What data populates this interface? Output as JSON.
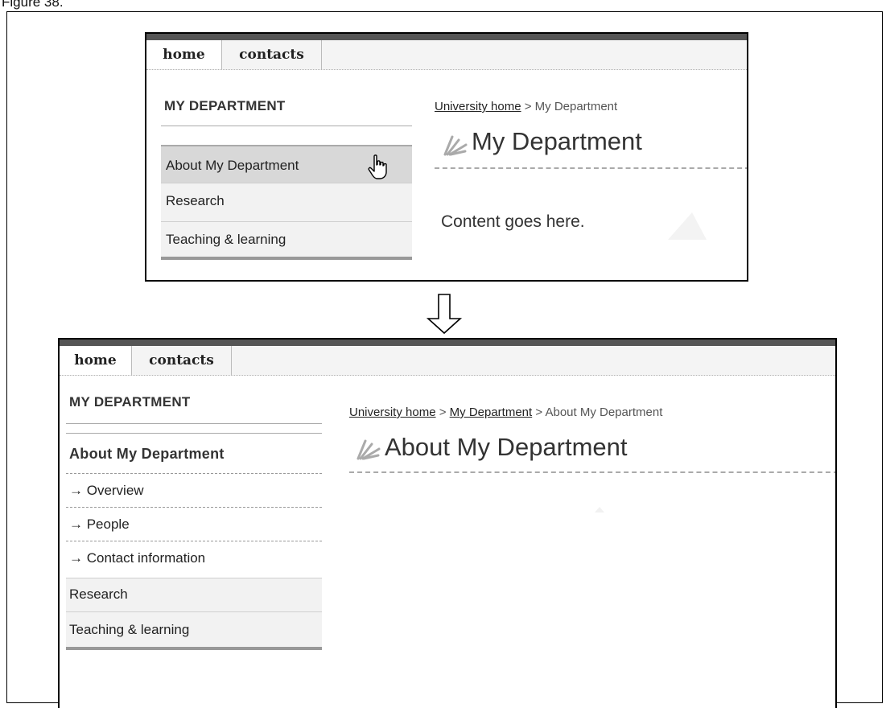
{
  "figure_label": "Figure 38.",
  "nav": {
    "home": "home",
    "contacts": "contacts"
  },
  "before": {
    "sidebar_heading": "MY DEPARTMENT",
    "sidebar_items": [
      "About My Department",
      "Research",
      "Teaching & learning"
    ],
    "breadcrumb": {
      "link1": "University home",
      "sep": " > ",
      "current": "My Department"
    },
    "page_title": "My Department",
    "content": "Content goes here."
  },
  "after": {
    "sidebar_heading": "MY DEPARTMENT",
    "section_heading": "About My Department",
    "sub_items": [
      "→ Overview",
      "→ People",
      "→ Contact information"
    ],
    "sidebar_items": [
      "Research",
      "Teaching & learning"
    ],
    "breadcrumb": {
      "link1": "University home",
      "sep1": " > ",
      "link2": "My Department",
      "sep2": " > ",
      "current": "About My Department"
    },
    "page_title": "About My Department"
  }
}
